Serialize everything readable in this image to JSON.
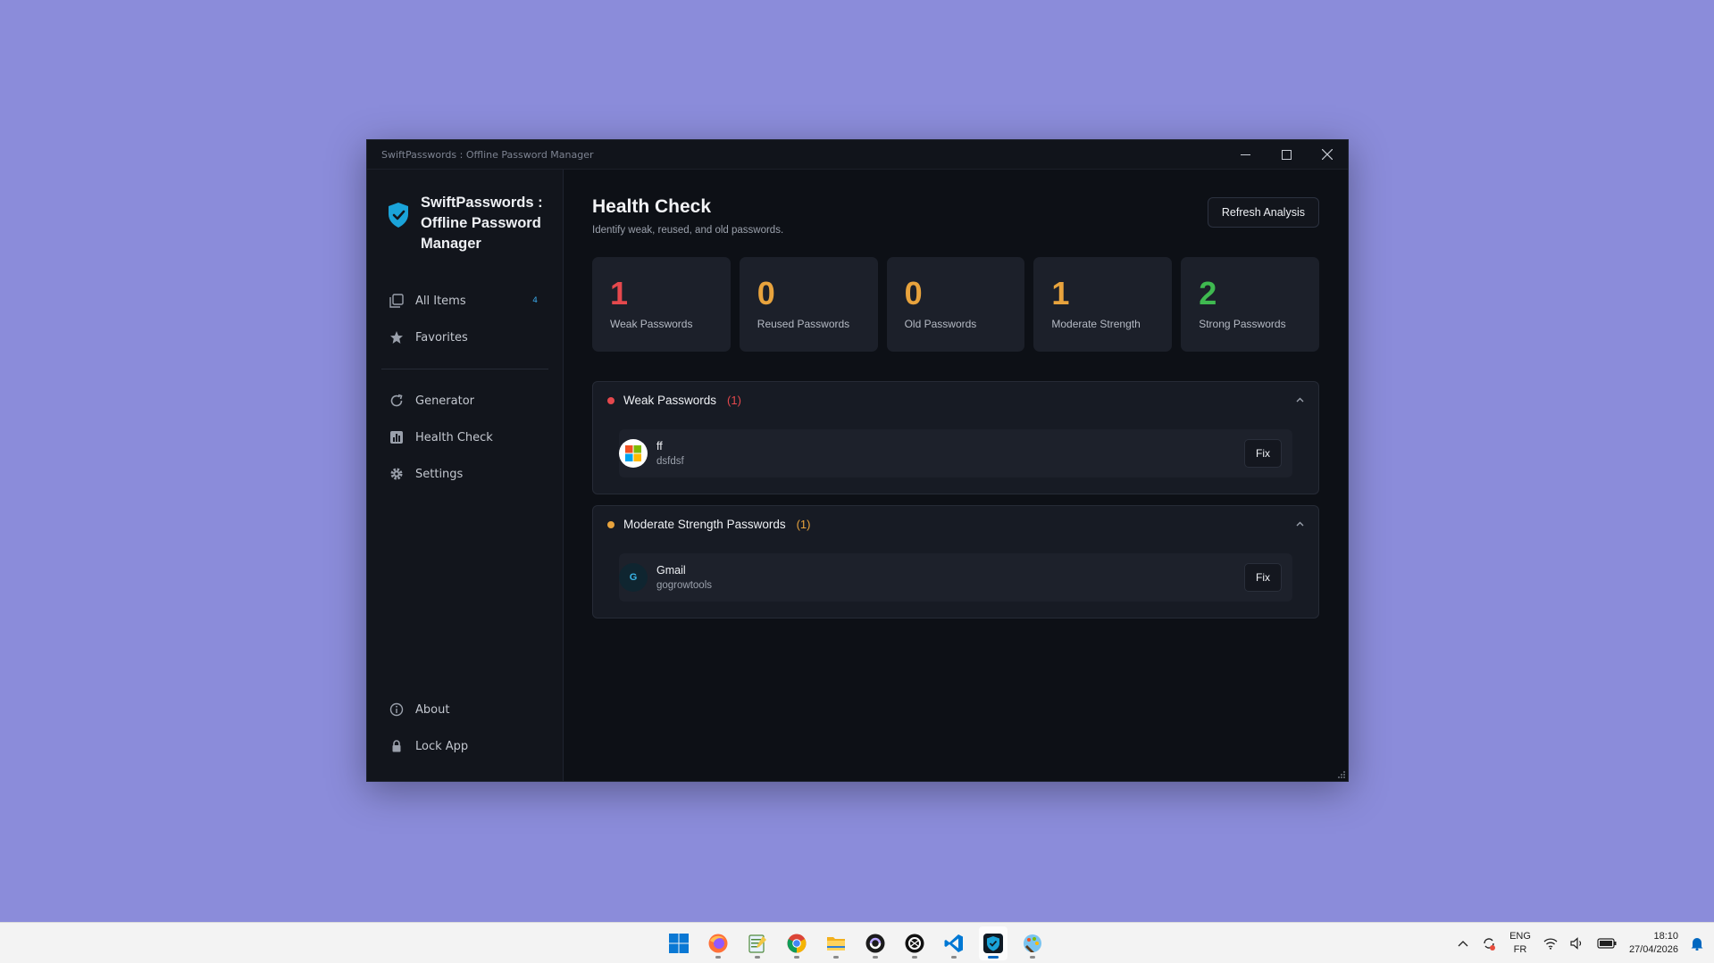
{
  "window": {
    "title": "SwiftPasswords : Offline Password Manager"
  },
  "sidebar": {
    "brand": "SwiftPasswords : Offline Password Manager",
    "items": [
      {
        "label": "All Items",
        "icon": "all-items-icon",
        "badge": "4"
      },
      {
        "label": "Favorites",
        "icon": "star-icon"
      },
      {
        "label": "Generator",
        "icon": "refresh-icon"
      },
      {
        "label": "Health Check",
        "icon": "chart-icon"
      },
      {
        "label": "Settings",
        "icon": "gear-icon"
      }
    ],
    "bottom": [
      {
        "label": "About",
        "icon": "info-icon"
      },
      {
        "label": "Lock App",
        "icon": "lock-icon"
      }
    ]
  },
  "main": {
    "title": "Health Check",
    "subtitle": "Identify weak, reused, and old passwords.",
    "refresh_label": "Refresh Analysis",
    "stats": [
      {
        "value": "1",
        "label": "Weak Passwords",
        "color": "#e5484d"
      },
      {
        "value": "0",
        "label": "Reused Passwords",
        "color": "#e8a33d"
      },
      {
        "value": "0",
        "label": "Old Passwords",
        "color": "#e8a33d"
      },
      {
        "value": "1",
        "label": "Moderate Strength",
        "color": "#e8a33d"
      },
      {
        "value": "2",
        "label": "Strong Passwords",
        "color": "#3fb950"
      }
    ],
    "sections": [
      {
        "title": "Weak Passwords",
        "count": "(1)",
        "color": "#e5484d",
        "entries": [
          {
            "name": "ff",
            "username": "dsfdsf",
            "icon": "microsoft-icon",
            "fix_label": "Fix"
          }
        ]
      },
      {
        "title": "Moderate Strength Passwords",
        "count": "(1)",
        "color": "#e8a33d",
        "entries": [
          {
            "name": "Gmail",
            "username": "gogrowtools",
            "icon": "google-icon",
            "avatar_letter": "G",
            "fix_label": "Fix"
          }
        ]
      }
    ]
  },
  "taskbar": {
    "apps": [
      "start-icon",
      "firefox-icon",
      "notepad-icon",
      "chrome-icon",
      "file-explorer-icon",
      "app-icon",
      "app-icon",
      "vscode-icon",
      "swiftpasswords-icon",
      "paint-icon"
    ],
    "language": {
      "line1": "ENG",
      "line2": "FR"
    },
    "time": "18:10",
    "date": "27/04/2026"
  }
}
